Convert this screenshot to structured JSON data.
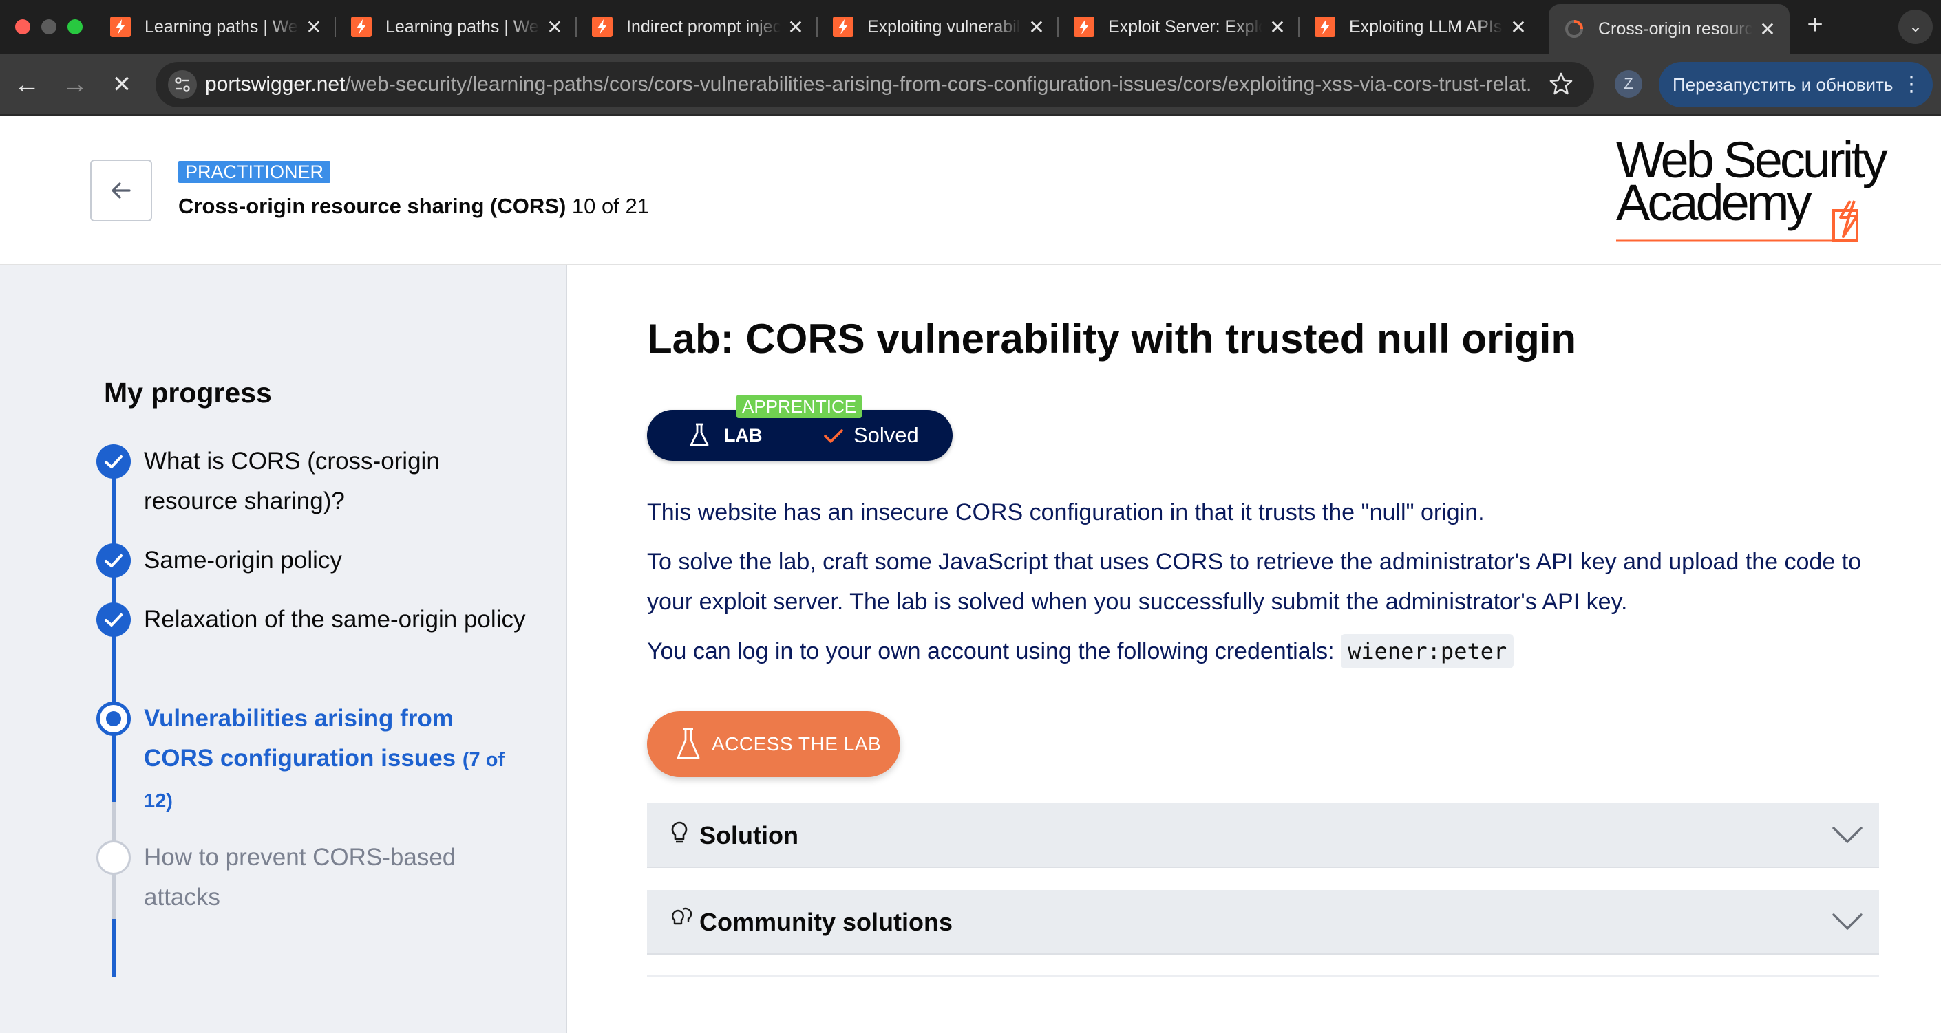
{
  "browser": {
    "tabs": [
      {
        "title": "Learning paths | Web Security Academy",
        "active": false
      },
      {
        "title": "Learning paths | Web Security Academy",
        "active": false
      },
      {
        "title": "Indirect prompt injection",
        "active": false
      },
      {
        "title": "Exploiting vulnerabilities",
        "active": false
      },
      {
        "title": "Exploit Server: Exploiting",
        "active": false
      },
      {
        "title": "Exploiting LLM APIs",
        "active": false
      },
      {
        "title": "Cross-origin resource sharing",
        "active": true
      }
    ],
    "url_host": "portswigger.net",
    "url_path": "/web-security/learning-paths/cors/cors-vulnerabilities-arising-from-cors-configuration-issues/cors/exploiting-xss-via-cors-trust-relat...",
    "profile_initial": "Z",
    "relaunch_label": "Перезапустить и обновить"
  },
  "header": {
    "level": "PRACTITIONER",
    "topic": "Cross-origin resource sharing (CORS)",
    "progress": "10 of 21",
    "logo_line1": "Web Security",
    "logo_line2": "Academy"
  },
  "sidebar": {
    "title": "My progress",
    "steps": [
      {
        "label": "What is CORS (cross-origin resource sharing)?",
        "state": "done"
      },
      {
        "label": "Same-origin policy",
        "state": "done"
      },
      {
        "label": "Relaxation of the same-origin policy",
        "state": "done"
      },
      {
        "label": "Vulnerabilities arising from CORS configuration issues",
        "count": "(7 of 12)",
        "state": "current"
      },
      {
        "label": "How to prevent CORS-based attacks",
        "state": "todo"
      }
    ]
  },
  "main": {
    "title": "Lab: CORS vulnerability with trusted null origin",
    "difficulty": "APPRENTICE",
    "lab_label": "LAB",
    "status": "Solved",
    "p1": "This website has an insecure CORS configuration in that it trusts the \"null\" origin.",
    "p2": "To solve the lab, craft some JavaScript that uses CORS to retrieve the administrator's API key and upload the code to your exploit server. The lab is solved when you successfully submit the administrator's API key.",
    "p3": "You can log in to your own account using the following credentials:",
    "credentials": "wiener:peter",
    "access_button": "ACCESS THE LAB",
    "solution_label": "Solution",
    "community_label": "Community solutions"
  },
  "colors": {
    "accent_blue": "#1d61cf",
    "practitioner_badge": "#3b8ee8",
    "apprentice_badge": "#70d151",
    "lab_pill": "#00164a",
    "access_button": "#ed7a4a",
    "logo_orange": "#ff6633"
  }
}
